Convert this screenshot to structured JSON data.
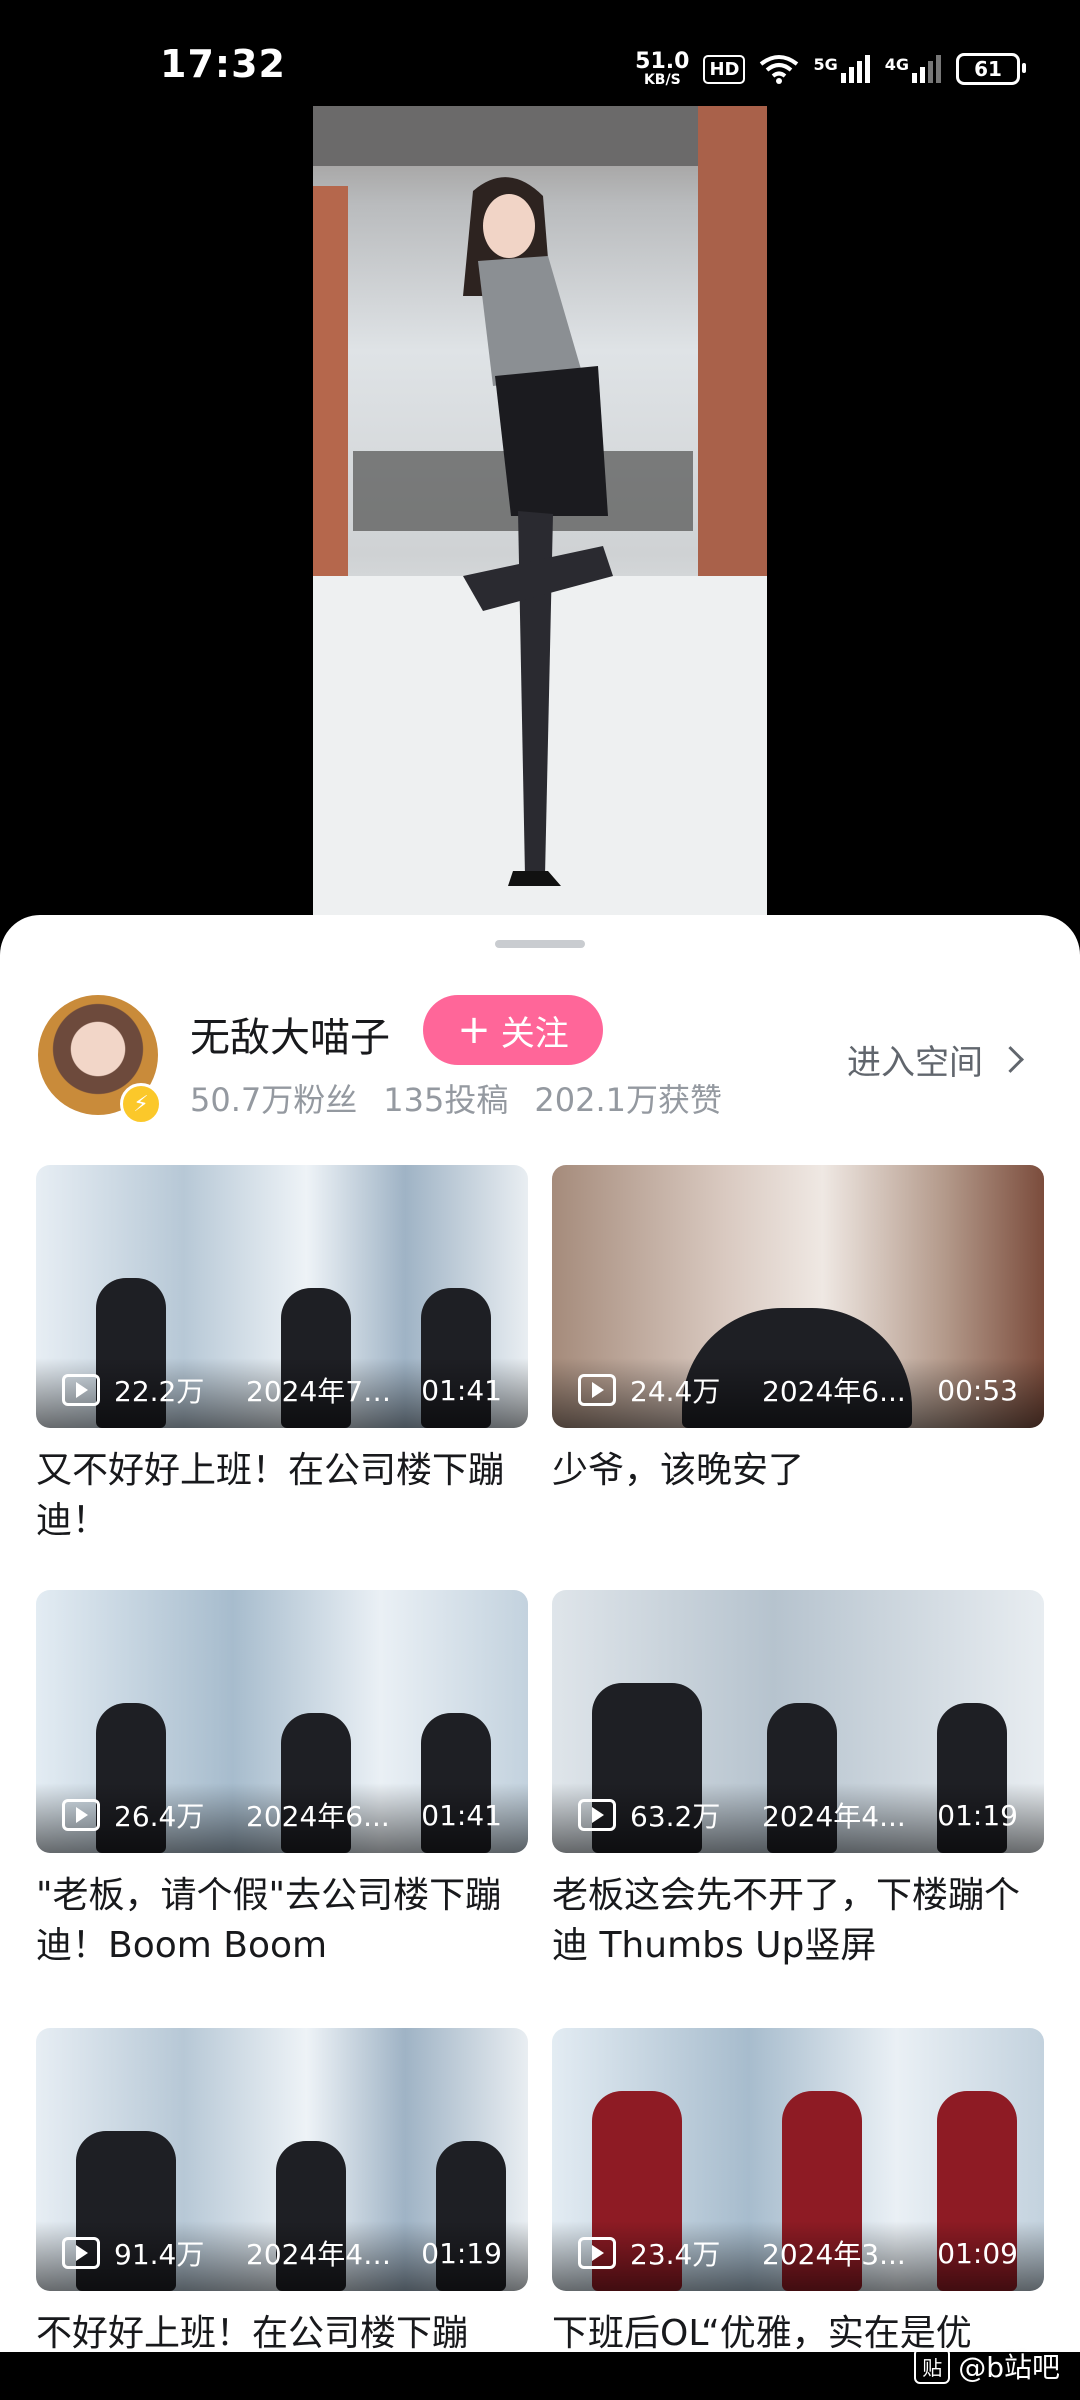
{
  "status_bar": {
    "time": "17:32",
    "net_speed_value": "51.0",
    "net_speed_unit": "KB/S",
    "hd": "HD",
    "net_5g": "5G",
    "net_4g": "4G",
    "battery": "61"
  },
  "uploader": {
    "name": "无敌大喵子",
    "follow_label": "关注",
    "stats": [
      "50.7万粉丝",
      "135投稿",
      "202.1万获赞"
    ],
    "space_link": "进入空间"
  },
  "videos": [
    {
      "views": "22.2万",
      "date": "2024年7月...",
      "duration": "01:41",
      "title": "又不好好上班！在公司楼下蹦迪！"
    },
    {
      "views": "24.4万",
      "date": "2024年6...",
      "duration": "00:53",
      "title": "少爷，该晚安了"
    },
    {
      "views": "26.4万",
      "date": "2024年6...",
      "duration": "01:41",
      "title": "\"老板，请个假\"去公司楼下蹦迪！Boom Boom"
    },
    {
      "views": "63.2万",
      "date": "2024年4...",
      "duration": "01:19",
      "title": "老板这会先不开了，下楼蹦个迪 Thumbs Up竖屏"
    },
    {
      "views": "91.4万",
      "date": "2024年4月...",
      "duration": "01:19",
      "title": "不好好上班！在公司楼下蹦"
    },
    {
      "views": "23.4万",
      "date": "2024年3...",
      "duration": "01:09",
      "title": "下班后OL“优雅，实在是优"
    }
  ],
  "watermark": "@b站吧",
  "watermark_box": "贴"
}
